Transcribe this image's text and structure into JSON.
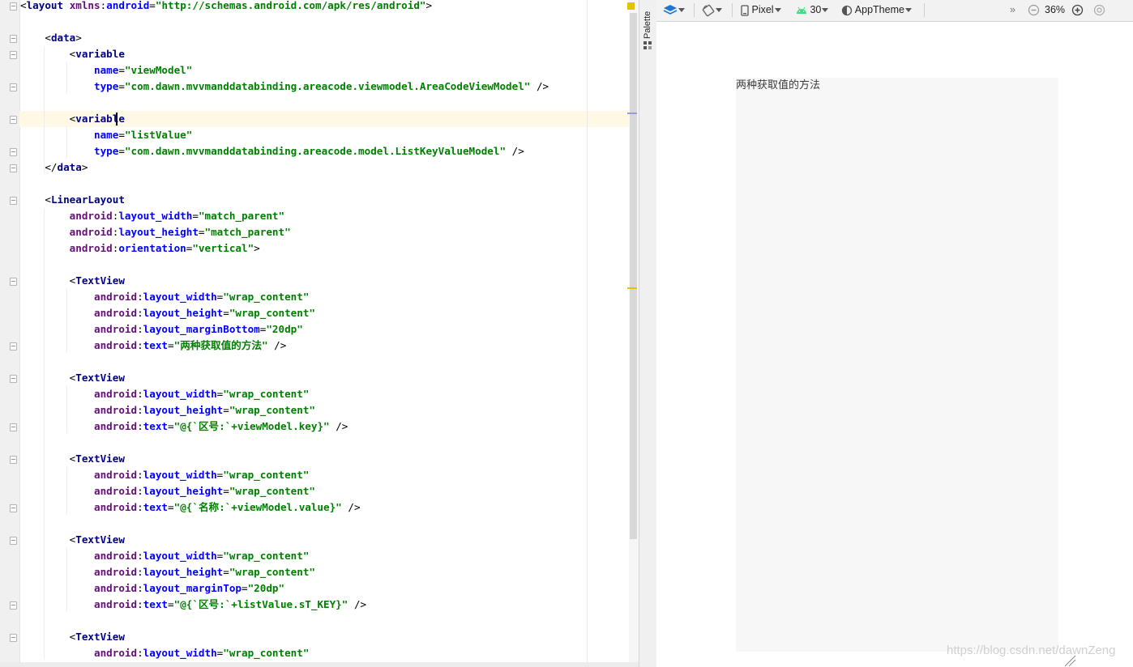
{
  "editor": {
    "lines": [
      "<layout xmlns:android=\"http://schemas.android.com/apk/res/android\">",
      "",
      "    <data>",
      "        <variable",
      "            name=\"viewModel\"",
      "            type=\"com.dawn.mvvmanddatabinding.areacode.viewmodel.AreaCodeViewModel\" />",
      "",
      "        <variable",
      "            name=\"listValue\"",
      "            type=\"com.dawn.mvvmanddatabinding.areacode.model.ListKeyValueModel\" />",
      "    </data>",
      "",
      "    <LinearLayout",
      "        android:layout_width=\"match_parent\"",
      "        android:layout_height=\"match_parent\"",
      "        android:orientation=\"vertical\">",
      "",
      "        <TextView",
      "            android:layout_width=\"wrap_content\"",
      "            android:layout_height=\"wrap_content\"",
      "            android:layout_marginBottom=\"20dp\"",
      "            android:text=\"两种获取值的方法\" />",
      "",
      "        <TextView",
      "            android:layout_width=\"wrap_content\"",
      "            android:layout_height=\"wrap_content\"",
      "            android:text=\"@{`区号:`+viewModel.key}\" />",
      "",
      "        <TextView",
      "            android:layout_width=\"wrap_content\"",
      "            android:layout_height=\"wrap_content\"",
      "            android:text=\"@{`名称:`+viewModel.value}\" />",
      "",
      "        <TextView",
      "            android:layout_width=\"wrap_content\"",
      "            android:layout_height=\"wrap_content\"",
      "            android:layout_marginTop=\"20dp\"",
      "            android:text=\"@{`区号:`+listValue.sT_KEY}\" />",
      "",
      "        <TextView",
      "            android:layout_width=\"wrap_content\""
    ],
    "highlighted_line": 8,
    "highlighted_text_line": 22
  },
  "palette": {
    "label": "Palette"
  },
  "toolbar": {
    "device": "Pixel",
    "api_level": "30",
    "theme": "AppTheme",
    "overflow": "»",
    "zoom": "36%"
  },
  "preview": {
    "text": "两种获取值的方法"
  },
  "watermark": {
    "text": "https://blog.csdn.net/dawnZeng"
  },
  "colors": {
    "xml_tag": "#000080",
    "xml_attribute": "#0000ff",
    "xml_namespace": "#660e7a",
    "xml_value": "#008000",
    "current_line": "#fdf9e4",
    "design_surface": "#f7f7f7"
  },
  "icons": {
    "design_surface": "layers-icon",
    "orientation": "rotate-icon",
    "device": "phone-icon",
    "api": "android-icon",
    "theme": "theme-icon",
    "zoom_out": "zoom-out-icon",
    "zoom_in": "zoom-in-icon",
    "zoom_fit": "zoom-fit-icon"
  }
}
